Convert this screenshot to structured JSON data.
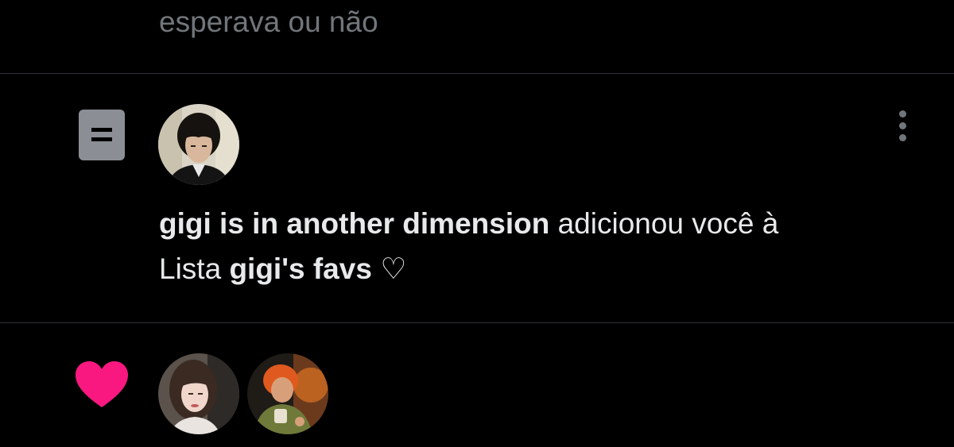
{
  "previous": {
    "text": "esperava ou não"
  },
  "list_notification": {
    "actor_name": "gigi is in another dimension",
    "action_text": " adicionou você à",
    "list_prefix": "Lista ",
    "list_name": "gigi's favs ♡",
    "icon": "list-icon",
    "more_icon": "more-vertical-icon",
    "avatar_alt": "gigi profile picture"
  },
  "like_notification": {
    "icon": "heart-icon",
    "heart_color": "#f91880",
    "avatars": [
      {
        "alt": "liker 1 profile picture"
      },
      {
        "alt": "liker 2 profile picture"
      }
    ]
  },
  "colors": {
    "background": "#000000",
    "primary_text": "#e7e9ea",
    "secondary_text": "#71767b",
    "divider": "#2f3336",
    "list_icon": "#8b8f95"
  }
}
